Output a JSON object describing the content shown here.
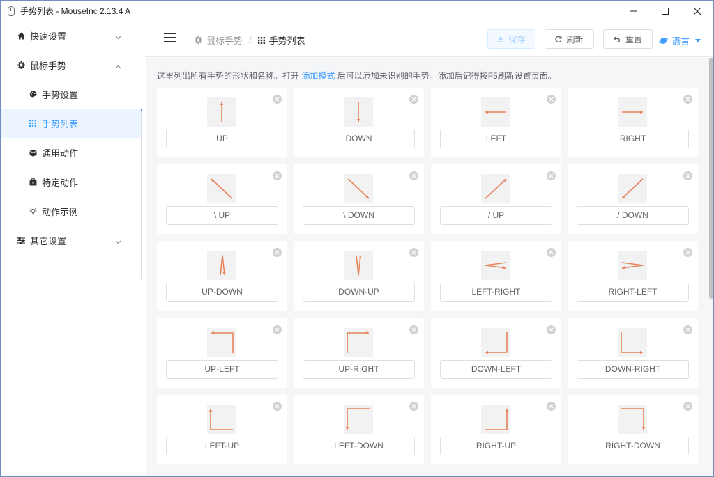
{
  "window": {
    "title": "手势列表 - MouseInc 2.13.4 A",
    "minimize_glyph": "—",
    "maximize_glyph": "☐",
    "close_glyph": "✕"
  },
  "sidebar": {
    "items": [
      {
        "label": "快速设置",
        "icon": "home-icon",
        "expanded": false
      },
      {
        "label": "鼠标手势",
        "icon": "gear-icon",
        "expanded": true
      },
      {
        "label": "手势设置",
        "icon": "palette-icon"
      },
      {
        "label": "手势列表",
        "icon": "grid-icon",
        "active": true
      },
      {
        "label": "通用动作",
        "icon": "cube-icon"
      },
      {
        "label": "特定动作",
        "icon": "briefcase-icon"
      },
      {
        "label": "动作示例",
        "icon": "bulb-icon"
      },
      {
        "label": "其它设置",
        "icon": "sliders-icon",
        "expanded": false
      }
    ]
  },
  "header": {
    "breadcrumb": [
      {
        "label": "鼠标手势",
        "icon": "gear-icon"
      },
      {
        "label": "手势列表",
        "icon": "grid-icon"
      }
    ],
    "breadcrumb_separator": "/",
    "save_label": "保存",
    "refresh_label": "刷新",
    "reset_label": "重置",
    "language_label": "语言"
  },
  "main": {
    "intro_before": "这里列出所有手势的形状和名称。打开 ",
    "intro_link": "添加模式",
    "intro_after": " 后可以添加未识别的手势。添加后记得按F5刷新设置页面。",
    "gestures": [
      {
        "name": "UP",
        "path": "up"
      },
      {
        "name": "DOWN",
        "path": "down"
      },
      {
        "name": "LEFT",
        "path": "left"
      },
      {
        "name": "RIGHT",
        "path": "right"
      },
      {
        "name": "\\ UP",
        "path": "bs-up"
      },
      {
        "name": "\\ DOWN",
        "path": "bs-down"
      },
      {
        "name": "/ UP",
        "path": "sl-up"
      },
      {
        "name": "/ DOWN",
        "path": "sl-down"
      },
      {
        "name": "UP-DOWN",
        "path": "up-down"
      },
      {
        "name": "DOWN-UP",
        "path": "down-up"
      },
      {
        "name": "LEFT-RIGHT",
        "path": "left-right"
      },
      {
        "name": "RIGHT-LEFT",
        "path": "right-left"
      },
      {
        "name": "UP-LEFT",
        "path": "up-left"
      },
      {
        "name": "UP-RIGHT",
        "path": "up-right"
      },
      {
        "name": "DOWN-LEFT",
        "path": "down-left"
      },
      {
        "name": "DOWN-RIGHT",
        "path": "down-right"
      },
      {
        "name": "LEFT-UP",
        "path": "left-up"
      },
      {
        "name": "LEFT-DOWN",
        "path": "left-down"
      },
      {
        "name": "RIGHT-UP",
        "path": "right-up"
      },
      {
        "name": "RIGHT-DOWN",
        "path": "right-down"
      }
    ]
  },
  "colors": {
    "accent": "#409eff",
    "stroke": "#e8825a",
    "background": "#f5f6f8"
  }
}
